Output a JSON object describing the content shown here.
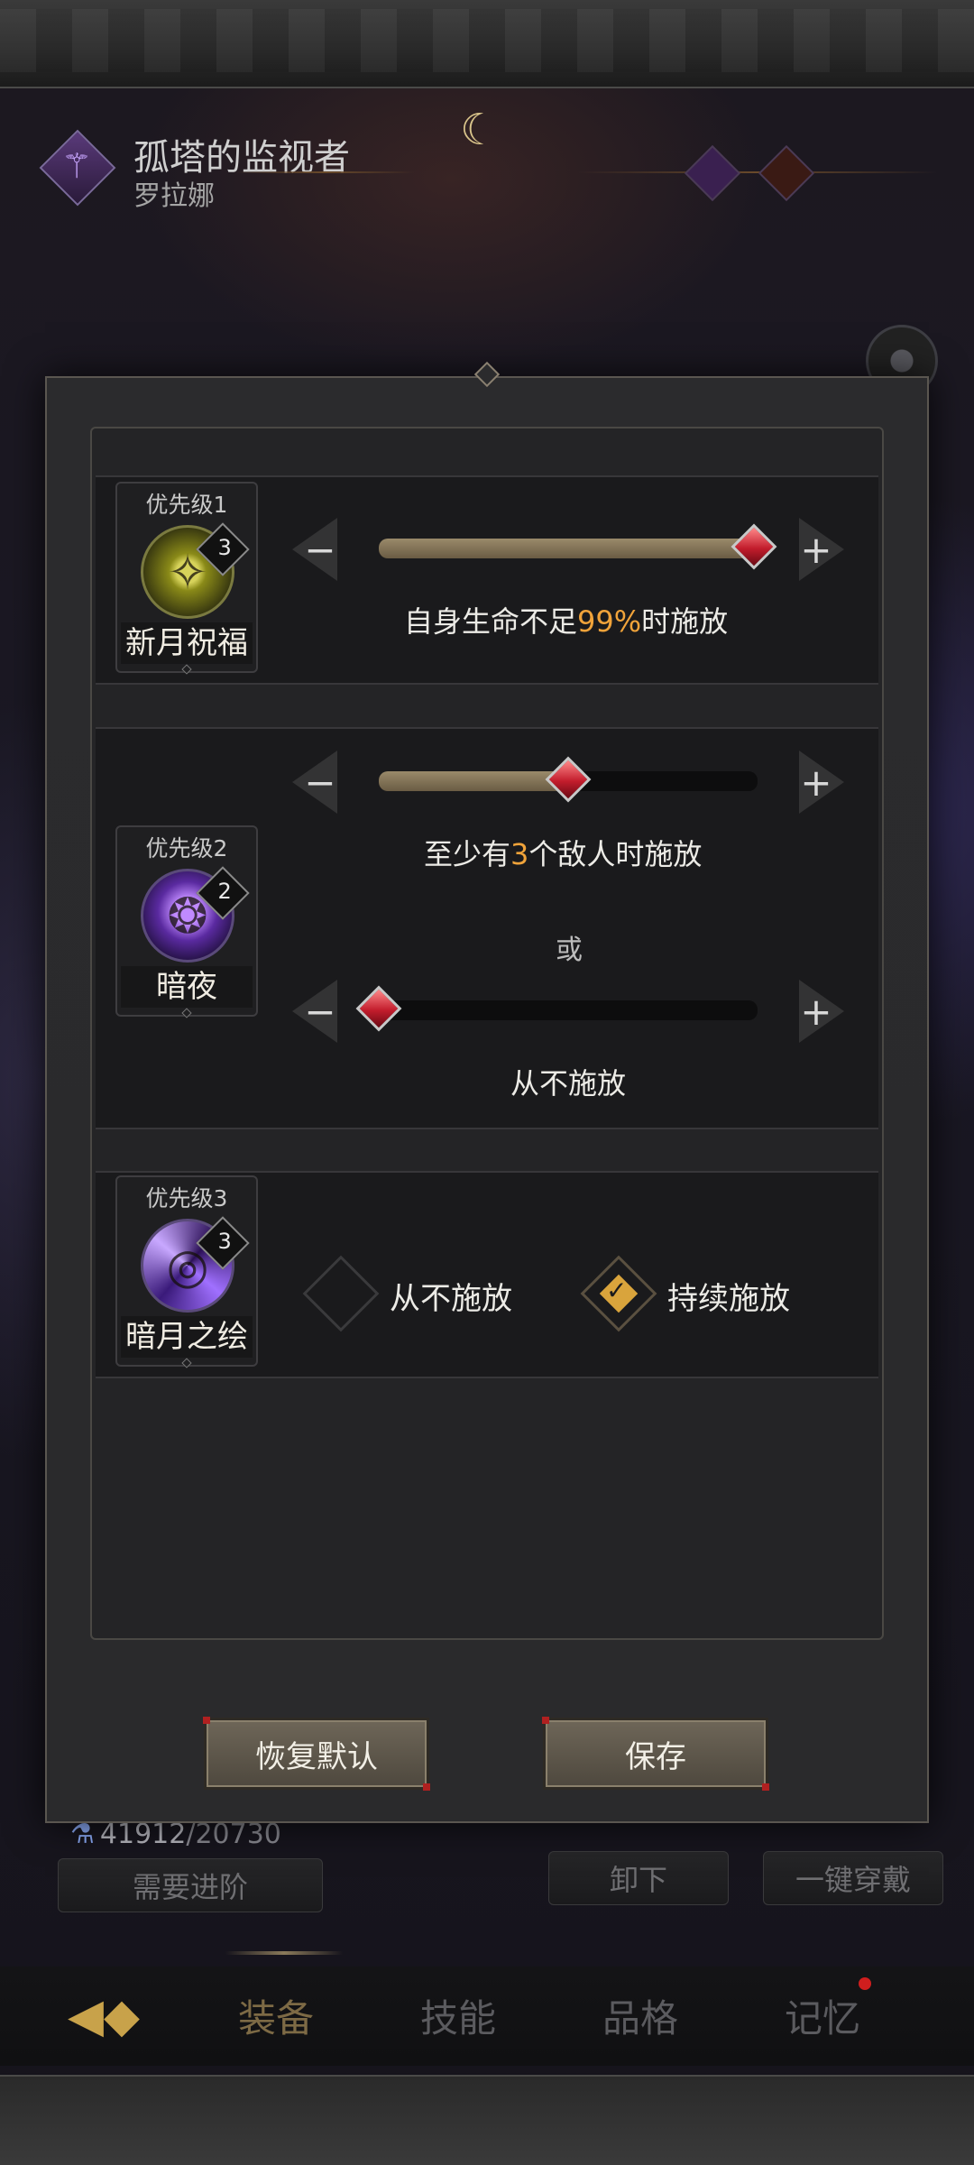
{
  "character": {
    "name": "孤塔的监视者",
    "subtitle": "罗拉娜"
  },
  "background": {
    "resource_current": "41912",
    "resource_max": "/20730",
    "advance_button": "需要进阶",
    "unequip_button": "卸下",
    "equip_all_button": "一键穿戴"
  },
  "bottom_nav": {
    "tabs": [
      "装备",
      "技能",
      "品格",
      "记忆"
    ],
    "active": "装备"
  },
  "skills": [
    {
      "priority": "优先级1",
      "name": "新月祝福",
      "level": "3",
      "condition_prefix": "自身生命不足",
      "condition_value": "99%",
      "condition_suffix": "时施放",
      "slider_value": 0.99
    },
    {
      "priority": "优先级2",
      "name": "暗夜",
      "level": "2",
      "condition1_prefix": "至少有",
      "condition1_value": "3",
      "condition1_suffix": "个敌人时施放",
      "slider1_value": 0.5,
      "or_text": "或",
      "condition2": "从不施放",
      "slider2_value": 0.0
    },
    {
      "priority": "优先级3",
      "name": "暗月之绘",
      "level": "3",
      "option_never": "从不施放",
      "option_always": "持续施放",
      "selected": "持续施放"
    }
  ],
  "buttons": {
    "reset": "恢复默认",
    "save": "保存"
  },
  "colors": {
    "highlight": "#f0a33a",
    "knob": "#c21c2c",
    "panel": "#2b2b2d"
  }
}
